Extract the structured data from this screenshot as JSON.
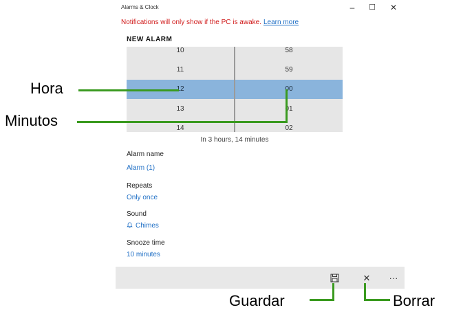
{
  "window": {
    "title": "Alarms & Clock",
    "minimize_glyph": "–",
    "maximize_glyph": "☐",
    "close_glyph": "✕"
  },
  "notice": {
    "text": "Notifications will only show if the PC is awake.",
    "link": "Learn more",
    "color": "#d01a1a"
  },
  "new_alarm": {
    "heading": "NEW ALARM",
    "hours": [
      "10",
      "11",
      "12",
      "13",
      "14"
    ],
    "minutes": [
      "58",
      "59",
      "00",
      "01",
      "02"
    ],
    "selected_hour": "12",
    "selected_minute": "00",
    "relative_time": "In 3 hours, 14 minutes",
    "selection_color": "#8ab4dc"
  },
  "fields": {
    "alarm_name_label": "Alarm name",
    "alarm_name_value": "Alarm (1)",
    "repeats_label": "Repeats",
    "repeats_value": "Only once",
    "sound_label": "Sound",
    "sound_value": "Chimes",
    "sound_icon": "bell-icon",
    "snooze_label": "Snooze time",
    "snooze_value": "10 minutes"
  },
  "command_bar": {
    "save_icon": "save-icon",
    "delete_icon": "close-icon",
    "more_icon": "more-icon",
    "more_glyph": "···",
    "delete_glyph": "✕"
  },
  "annotations": {
    "hora": "Hora",
    "minutos": "Minutos",
    "guardar": "Guardar",
    "borrar": "Borrar",
    "line_color": "#3a9a1f"
  }
}
